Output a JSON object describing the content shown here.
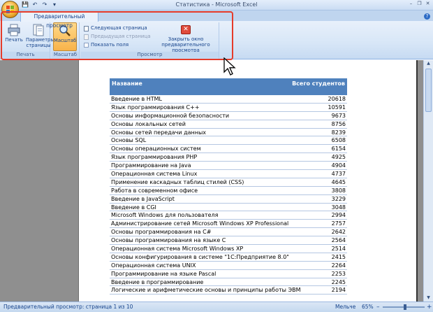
{
  "window": {
    "title": "Статистика - Microsoft Excel",
    "tab_label": "Предварительный просмотр"
  },
  "qat": {
    "save": "💾",
    "undo": "↶",
    "redo": "↷",
    "more": "▾"
  },
  "window_controls": {
    "minimize": "–",
    "restore": "❐",
    "close": "✕",
    "help": "?"
  },
  "ribbon": {
    "groups": {
      "print": {
        "label": "Печать",
        "print_button": "Печать",
        "page_setup_button": "Параметры страницы"
      },
      "zoom": {
        "label": "Масштаб",
        "zoom_button": "Масштаб"
      },
      "preview": {
        "label": "Просмотр",
        "next_page": "Следующая страница",
        "prev_page": "Предыдущая страница",
        "show_margins": "Показать поля",
        "close_preview": "Закрыть окно предварительного просмотра"
      }
    }
  },
  "table": {
    "header_name": "Название",
    "header_count": "Всего студентов",
    "rows": [
      {
        "name": "Введение в HTML",
        "count": "20618"
      },
      {
        "name": "Язык программирования С++",
        "count": "10591"
      },
      {
        "name": "Основы информационной безопасности",
        "count": "9673"
      },
      {
        "name": "Основы локальных сетей",
        "count": "8756"
      },
      {
        "name": "Основы сетей передачи данных",
        "count": "8239"
      },
      {
        "name": "Основы SQL",
        "count": "6508"
      },
      {
        "name": "Основы операционных систем",
        "count": "6154"
      },
      {
        "name": "Язык программирования PHP",
        "count": "4925"
      },
      {
        "name": "Программирование на Java",
        "count": "4904"
      },
      {
        "name": "Операционная система Linux",
        "count": "4737"
      },
      {
        "name": "Применение каскадных таблиц стилей (CSS)",
        "count": "4645"
      },
      {
        "name": "Работа в современном офисе",
        "count": "3808"
      },
      {
        "name": "Введение в JavaScript",
        "count": "3229"
      },
      {
        "name": "Введение в CGI",
        "count": "3048"
      },
      {
        "name": "Microsoft Windows для пользователя",
        "count": "2994"
      },
      {
        "name": "Администрирование сетей Microsoft Windows XP Professional",
        "count": "2757"
      },
      {
        "name": "Основы программирования на C#",
        "count": "2642"
      },
      {
        "name": "Основы программирования на языке С",
        "count": "2564"
      },
      {
        "name": "Операционная система Microsoft Windows XP",
        "count": "2514"
      },
      {
        "name": "Основы конфигурирования в системе \"1С:Предприятие 8.0\"",
        "count": "2415"
      },
      {
        "name": "Операционная система UNIX",
        "count": "2264"
      },
      {
        "name": "Программирование на языке Pascal",
        "count": "2253"
      },
      {
        "name": "Введение в программирование",
        "count": "2245"
      },
      {
        "name": "Логические и арифметические основы и принципы работы ЭВМ",
        "count": "2194"
      }
    ]
  },
  "status": {
    "text": "Предварительный просмотр: страница 1 из 10",
    "zoom_label": "Мельче",
    "zoom_percent": "65%",
    "zoom_minus": "–",
    "zoom_plus": "+"
  },
  "colors": {
    "highlight": "#e53b2a",
    "table_header": "#4f81bd"
  }
}
